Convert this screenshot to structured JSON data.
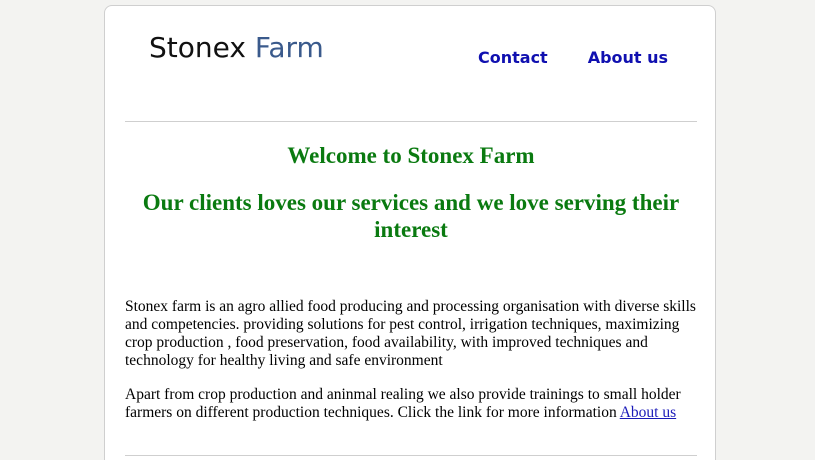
{
  "header": {
    "logo_part1": "Stonex ",
    "logo_part2": "Farm",
    "nav": {
      "contact": "Contact",
      "about": "About us"
    }
  },
  "main": {
    "welcome": "Welcome to Stonex Farm",
    "tagline": "Our clients loves our services and we love serving their interest",
    "paragraph1": "Stonex farm is an agro allied food producing and processing organisation with diverse skills and competencies. providing solutions for pest control, irrigation techniques, maximizing crop production , food preservation, food availability, with improved techniques and technology for healthy living and safe environment",
    "paragraph2": "Apart from crop production and aninmal realing we also provide trainings to small holder farmers on different production techniques. Click the link for more information",
    "about_link": "About us"
  },
  "colors": {
    "heading_green": "#0a7a10",
    "nav_blue": "#1010b0",
    "logo_blue": "#3a5a8c"
  }
}
